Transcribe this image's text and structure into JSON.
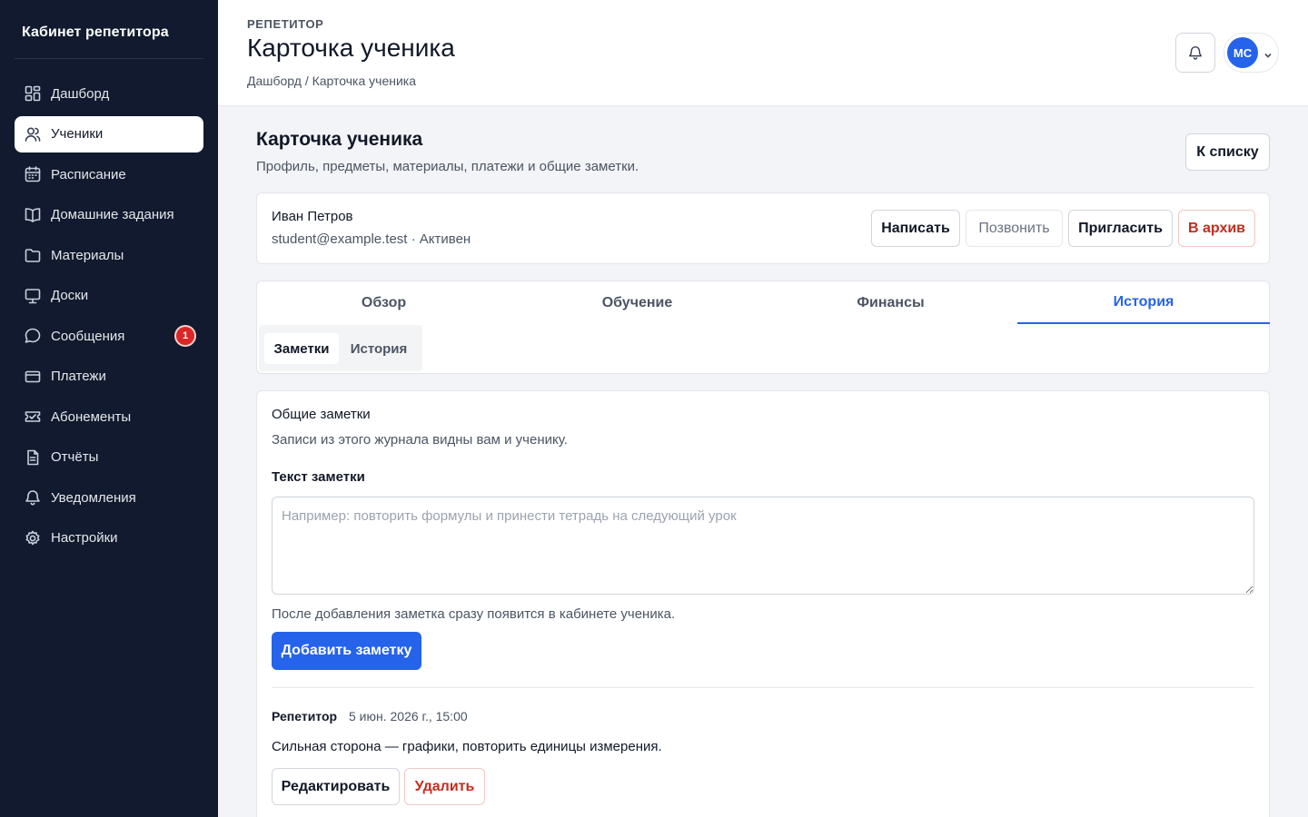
{
  "sidebar": {
    "brand": "Кабинет репетитора",
    "items": [
      {
        "label": "Дашборд",
        "icon": "dashboard-icon"
      },
      {
        "label": "Ученики",
        "icon": "users-icon",
        "active": true
      },
      {
        "label": "Расписание",
        "icon": "calendar-icon"
      },
      {
        "label": "Домашние задания",
        "icon": "book-icon"
      },
      {
        "label": "Материалы",
        "icon": "folder-icon"
      },
      {
        "label": "Доски",
        "icon": "board-icon"
      },
      {
        "label": "Сообщения",
        "icon": "chat-icon",
        "badge": "1"
      },
      {
        "label": "Платежи",
        "icon": "card-icon"
      },
      {
        "label": "Абонементы",
        "icon": "ticket-icon"
      },
      {
        "label": "Отчёты",
        "icon": "report-icon"
      },
      {
        "label": "Уведомления",
        "icon": "bell-icon"
      },
      {
        "label": "Настройки",
        "icon": "gear-icon"
      }
    ]
  },
  "header": {
    "role": "РЕПЕТИТОР",
    "title": "Карточка ученика",
    "breadcrumb": "Дашборд / Карточка ученика",
    "avatar_initials": "МС"
  },
  "main": {
    "title": "Карточка ученика",
    "subtitle": "Профиль, предметы, материалы, платежи и общие заметки.",
    "back_button": "К списку"
  },
  "student": {
    "name": "Иван Петров",
    "meta": "student@example.test · Активен",
    "actions": {
      "write": "Написать",
      "call": "Позвонить",
      "invite": "Пригласить",
      "archive": "В архив"
    }
  },
  "tabs": [
    {
      "label": "Обзор"
    },
    {
      "label": "Обучение"
    },
    {
      "label": "Финансы"
    },
    {
      "label": "История",
      "active": true
    }
  ],
  "subtabs": [
    {
      "label": "Заметки",
      "active": true
    },
    {
      "label": "История"
    }
  ],
  "notes": {
    "title": "Общие заметки",
    "subtitle": "Записи из этого журнала видны вам и ученику.",
    "field_label": "Текст заметки",
    "placeholder": "Например: повторить формулы и принести тетрадь на следующий урок",
    "hint": "После добавления заметка сразу появится в кабинете ученика.",
    "add_button": "Добавить заметку",
    "entry": {
      "author": "Репетитор",
      "date": "5 июн. 2026 г., 15:00",
      "text": "Сильная сторона — графики, повторить единицы измерения.",
      "edit_button": "Редактировать",
      "delete_button": "Удалить"
    }
  },
  "colors": {
    "sidebar_bg": "#111a2e",
    "accent": "#2563eb",
    "danger": "#c52b1f"
  }
}
